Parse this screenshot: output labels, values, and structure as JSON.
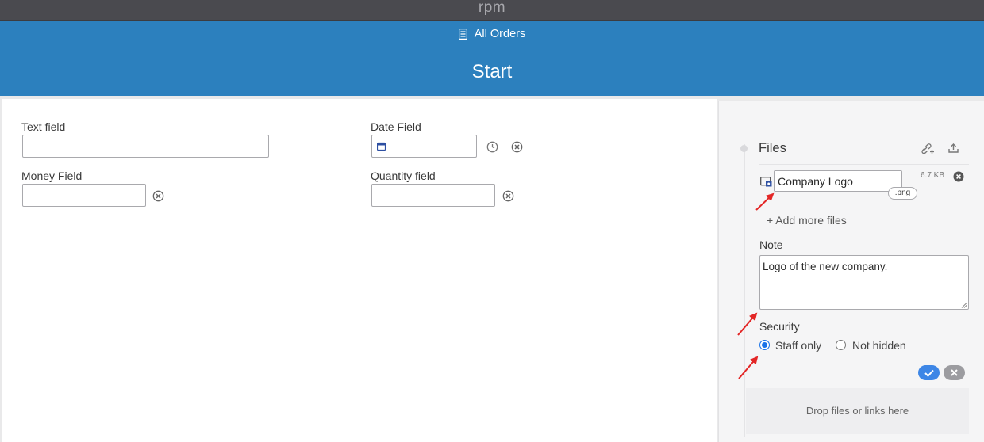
{
  "app": {
    "logo": "rpm"
  },
  "header": {
    "nav_label": "All Orders",
    "title": "Start"
  },
  "form": {
    "text_field": {
      "label": "Text field",
      "value": ""
    },
    "date_field": {
      "label": "Date Field",
      "value": ""
    },
    "money_field": {
      "label": "Money Field",
      "value": ""
    },
    "quantity_field": {
      "label": "Quantity field",
      "value": ""
    }
  },
  "files": {
    "title": "Files",
    "items": [
      {
        "name": "Company Logo",
        "extension": ".png",
        "size": "6.7 KB"
      }
    ],
    "add_more": "+ Add more files",
    "note_label": "Note",
    "note_value": "Logo of the new company.",
    "security_label": "Security",
    "security_options": [
      {
        "label": "Staff only",
        "selected": true
      },
      {
        "label": "Not hidden",
        "selected": false
      }
    ],
    "drop_text": "Drop files or links here"
  },
  "colors": {
    "header": "#2c80be",
    "topbar": "#4a4a4f",
    "accent": "#3d86e6",
    "annotation_arrow": "#e32626"
  },
  "icons": [
    "document-icon",
    "calendar-icon",
    "clock-icon",
    "clear-icon",
    "link-add-icon",
    "upload-icon",
    "image-file-icon",
    "remove-file-icon",
    "check-icon",
    "close-icon"
  ]
}
